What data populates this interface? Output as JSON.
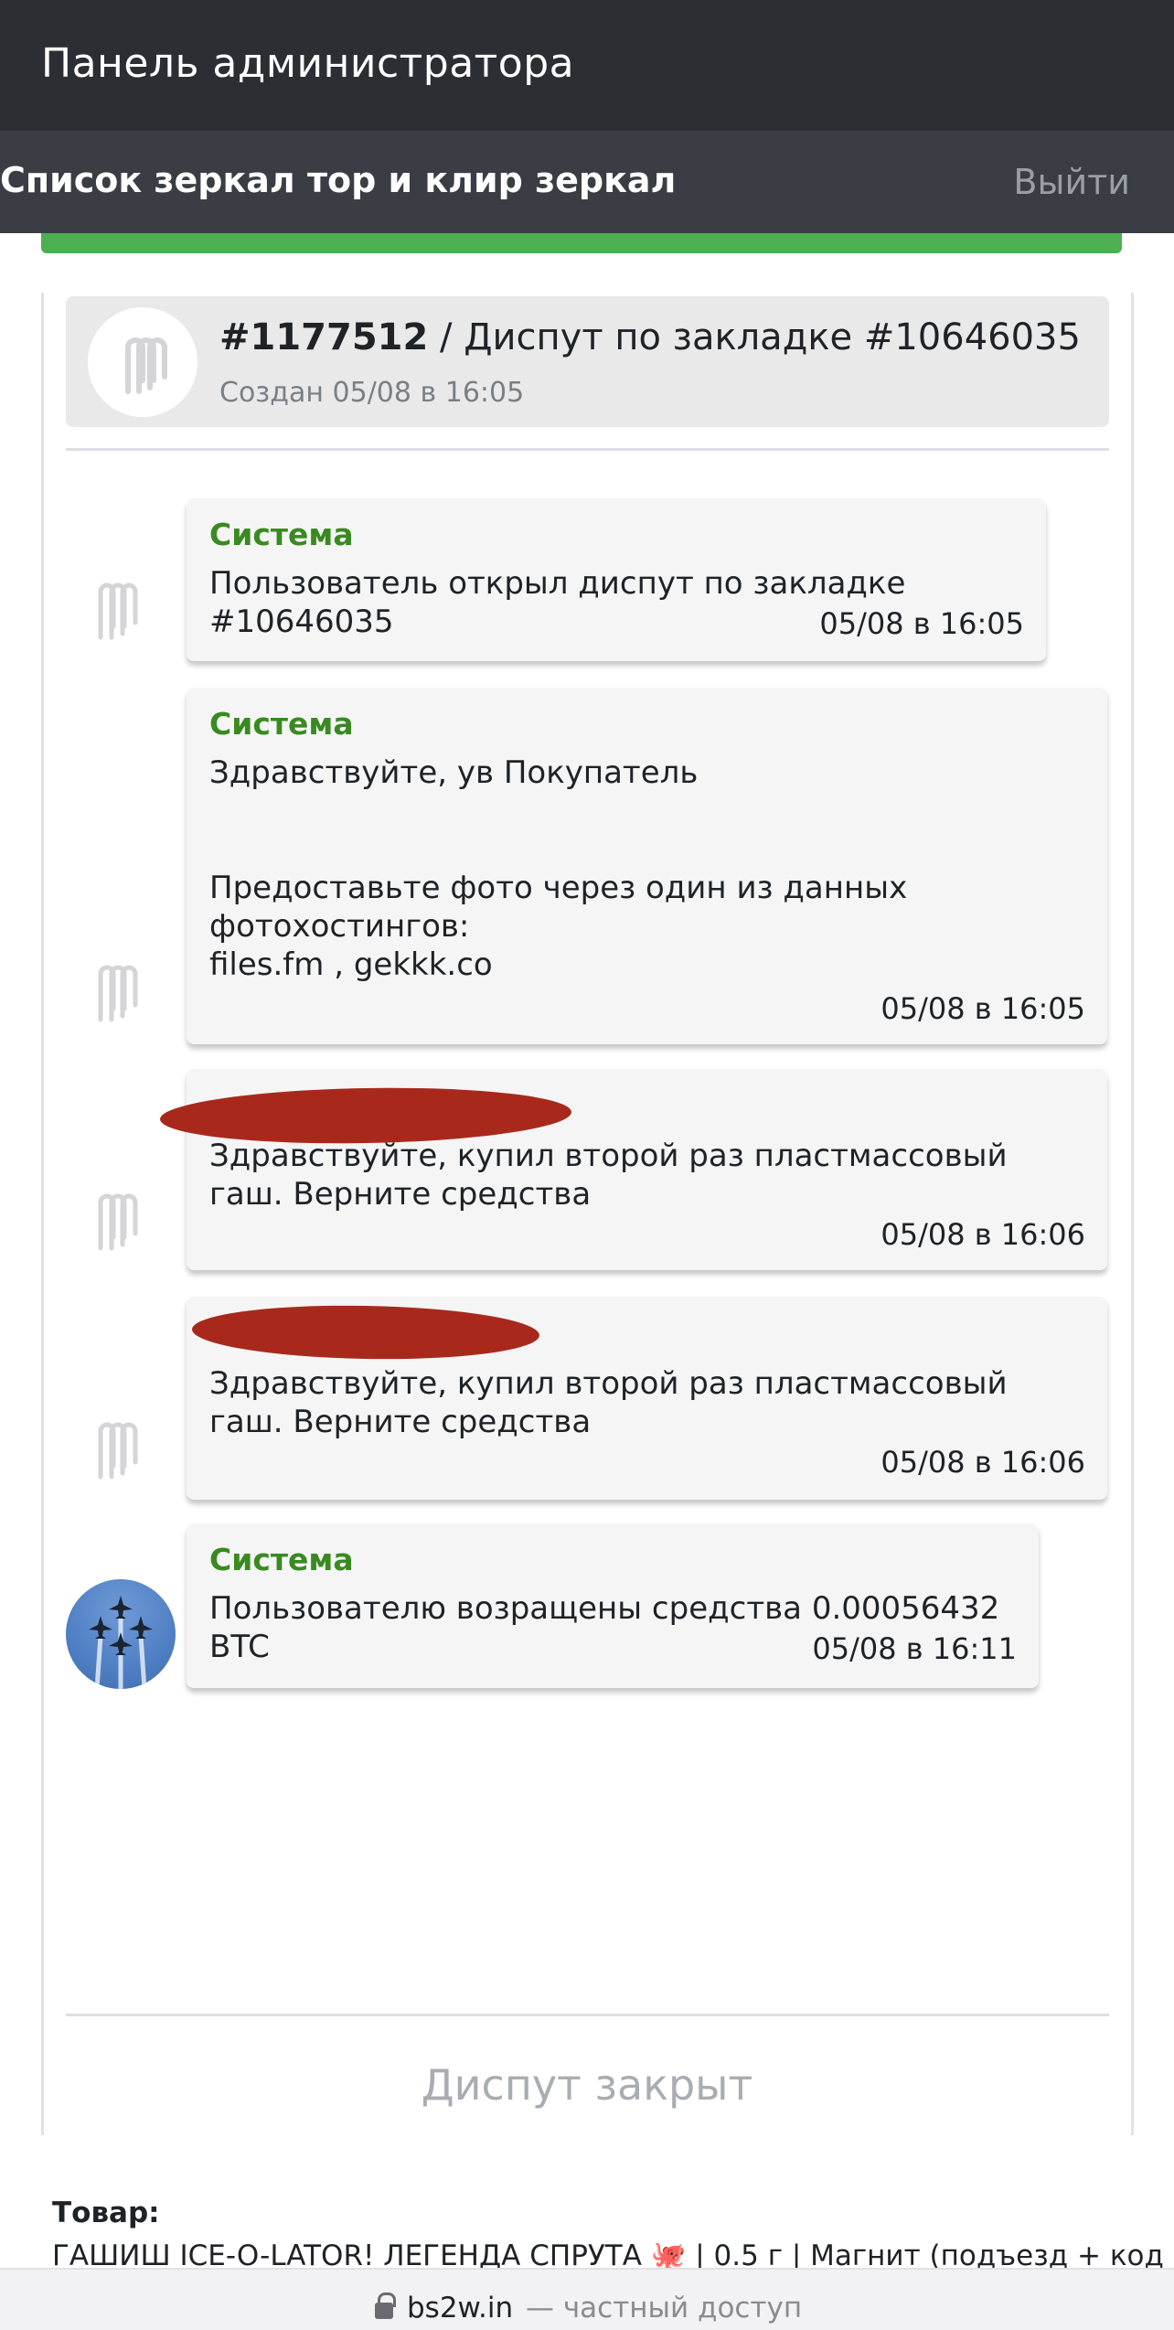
{
  "app_title": "Панель администратора",
  "nav": {
    "mirrors_link": "Список зеркал тор и клир зеркал",
    "logout": "Выйти"
  },
  "dispute": {
    "id": "#1177512",
    "title_rest": " / Диспут по закладке #10646035",
    "created": "Создан 05/08 в 16:05",
    "status": "Диспут закрыт"
  },
  "messages": [
    {
      "author": "Система",
      "text": "Пользователь открыл диспут по закладке #10646035",
      "time": "05/08 в 16:05"
    },
    {
      "author": "Система",
      "text_line1": "Здравствуйте, ув Покупатель",
      "text_line2": "Предоставьте фото через один из данных фотохостингов:",
      "text_line3": "files.fm , gekkk.co",
      "time": "05/08 в 16:05"
    },
    {
      "author": "",
      "text": "Здравствуйте, купил второй раз пластмассовый гаш. Верните средства",
      "time": "05/08 в 16:06"
    },
    {
      "author": "",
      "text": "Здравствуйте, купил второй раз пластмассовый гаш. Верните средства",
      "time": "05/08 в 16:06"
    },
    {
      "author": "Система",
      "text": "Пользователю возращены средства 0.00056432 BTC",
      "time": "05/08 в 16:11"
    }
  ],
  "product": {
    "label": "Товар:",
    "name": "ГАШИШ ICE-O-LATOR! ЛЕГЕНДА СПРУТА 🐙 | 0.5 г | Магнит (подъезд + код"
  },
  "browser": {
    "domain": "bs2w.in",
    "note": "— частный доступ"
  }
}
